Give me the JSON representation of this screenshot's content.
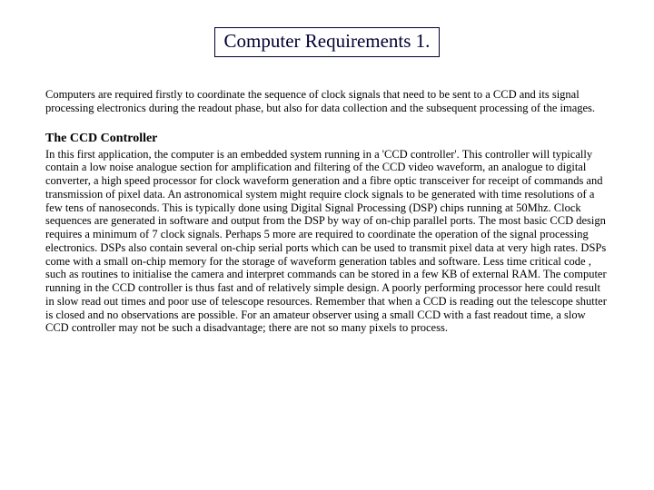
{
  "title": "Computer Requirements 1.",
  "intro": "Computers are required firstly to coordinate the sequence of clock signals that need to be sent to a CCD and its signal processing electronics during the readout phase, but also for data collection and the subsequent processing of the images.",
  "subhead": "The CCD Controller",
  "body": "In this first application, the computer is an embedded system running in a 'CCD controller'. This controller will typically contain a low noise analogue section for amplification and filtering of the CCD video waveform, an analogue to digital converter, a high speed processor for clock waveform generation and a fibre optic transceiver for receipt of commands and transmission of pixel data. An astronomical system might require clock signals to be generated with time resolutions of a few tens of nanoseconds. This is typically done using Digital Signal Processing (DSP) chips running at 50Mhz. Clock sequences are generated in software and output from the DSP by way of on-chip parallel ports. The most basic CCD design requires a minimum of 7 clock signals. Perhaps 5 more are required to coordinate the operation of the signal processing electronics. DSPs also contain several  on-chip serial ports which can be used to transmit pixel data at very high rates. DSPs come with a small on-chip memory for the storage of waveform generation tables and software. Less time critical code , such as routines to initialise the camera and interpret commands can be stored in a few KB of external RAM.  The computer running in the CCD controller is thus fast and of relatively simple design. A poorly performing processor here could result in slow read out times and poor use of telescope resources. Remember that when a CCD is reading out the telescope shutter is closed and no observations are possible. For an amateur observer using a small CCD with a fast readout time, a slow CCD controller may not be such a disadvantage; there are not so many pixels to process."
}
